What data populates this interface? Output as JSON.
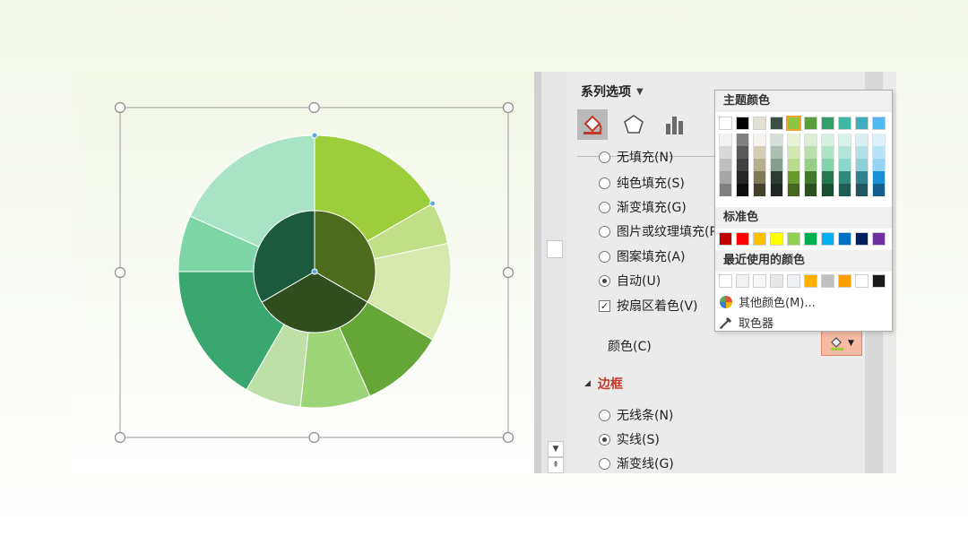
{
  "chart_data": {
    "type": "sunburst",
    "inner_ring": [
      {
        "share": 0.3333,
        "color": "#4d6b1c"
      },
      {
        "share": 0.3333,
        "color": "#2f4e1e"
      },
      {
        "share": 0.3334,
        "color": "#1b5a3c"
      }
    ],
    "outer_ring": [
      {
        "share": 0.1667,
        "color": "#9ccd3a"
      },
      {
        "share": 0.05,
        "color": "#c2df87"
      },
      {
        "share": 0.1167,
        "color": "#d7e9af"
      },
      {
        "share": 0.1,
        "color": "#66a637"
      },
      {
        "share": 0.0833,
        "color": "#9fd579"
      },
      {
        "share": 0.0666,
        "color": "#bde0a8"
      },
      {
        "share": 0.1667,
        "color": "#3aa86e"
      },
      {
        "share": 0.0667,
        "color": "#7ed5a6"
      },
      {
        "share": 0.1833,
        "color": "#a9e3c6"
      }
    ],
    "separator_color": "#ffffff"
  },
  "panel": {
    "title": "系列选项",
    "tabs": [
      {
        "name": "fill-line-icon",
        "active": true
      },
      {
        "name": "effects-pentagon-icon",
        "active": false
      },
      {
        "name": "series-options-bars-icon",
        "active": false
      }
    ],
    "fill_options": [
      {
        "label": "无填充(N)",
        "checked": false
      },
      {
        "label": "纯色填充(S)",
        "checked": false
      },
      {
        "label": "渐变填充(G)",
        "checked": false
      },
      {
        "label": "图片或纹理填充(P)",
        "checked": false
      },
      {
        "label": "图案填充(A)",
        "checked": false
      },
      {
        "label": "自动(U)",
        "checked": true
      }
    ],
    "vary_colors_label": "按扇区着色(V)",
    "vary_colors_checked": true,
    "color_label": "颜色(C)",
    "border_section": "边框",
    "border_options": [
      {
        "label": "无线条(N)",
        "checked": false
      },
      {
        "label": "实线(S)",
        "checked": true
      },
      {
        "label": "渐变线(G)",
        "checked": false
      }
    ]
  },
  "color_popup": {
    "theme_title": "主题颜色",
    "theme_colors": [
      "#ffffff",
      "#000000",
      "#e3e1d3",
      "#3d4f45",
      "#8dc43f",
      "#5a9e3b",
      "#30a06a",
      "#3fb8a3",
      "#40aebf",
      "#4fb8ef"
    ],
    "theme_selected_index": 4,
    "theme_shades": [
      [
        "#f2f2f2",
        "#d9d9d9",
        "#bfbfbf",
        "#a6a6a6",
        "#808080"
      ],
      [
        "#808080",
        "#595959",
        "#404040",
        "#262626",
        "#0d0d0d"
      ],
      [
        "#f5f4ee",
        "#d2ceb4",
        "#b4ae8b",
        "#7f7a56",
        "#44412d"
      ],
      [
        "#d6dfd9",
        "#aebfb4",
        "#84a08e",
        "#2e3b33",
        "#1f2822"
      ],
      [
        "#e9f3d8",
        "#d3e8b2",
        "#bbdb8c",
        "#6b9a2c",
        "#46661d"
      ],
      [
        "#ddeed6",
        "#bbdeae",
        "#98cd86",
        "#43772c",
        "#2d4f1d"
      ],
      [
        "#d5f1e2",
        "#abe3c5",
        "#81d5a8",
        "#24784f",
        "#185034"
      ],
      [
        "#d9f2ec",
        "#b2e4d9",
        "#8cd7c7",
        "#2f8a7a",
        "#1f5c51"
      ],
      [
        "#d9eff2",
        "#b3dfe5",
        "#8dcfd9",
        "#30828f",
        "#20575f"
      ],
      [
        "#dcf1fc",
        "#b9e3f9",
        "#95d4f5",
        "#1b8fd6",
        "#115f8f"
      ]
    ],
    "standard_title": "标准色",
    "standard_colors": [
      "#c00000",
      "#ff0000",
      "#ffc000",
      "#ffff00",
      "#92d050",
      "#00b050",
      "#00b0f0",
      "#0070c0",
      "#002060",
      "#7030a0"
    ],
    "recent_title": "最近使用的颜色",
    "recent_colors": [
      "#ffffff",
      "#f2f2f2",
      "#f7f7f7",
      "#e8e8e8",
      "#eef1f6",
      "#ffb000",
      "#bfbfbf",
      "#ff9e00",
      "#ffffff",
      "#1a1a1a"
    ],
    "more_colors_label": "其他颜色(M)...",
    "eyedropper_label": "取色器"
  }
}
